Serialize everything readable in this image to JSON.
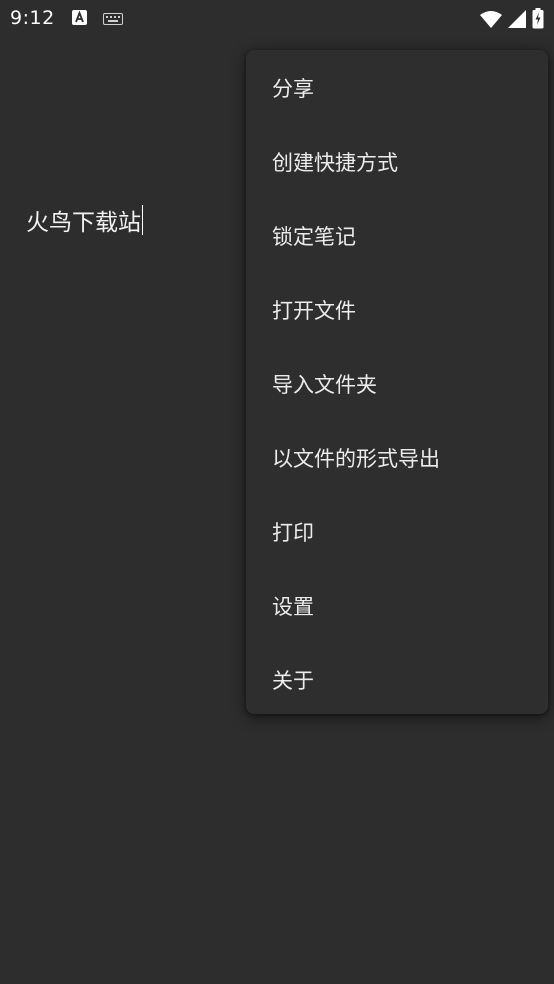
{
  "status_bar": {
    "time": "9:12",
    "notification_icons": [
      "font-a-icon",
      "keyboard-icon"
    ],
    "system_icons": [
      "wifi-icon",
      "cell-signal-icon",
      "battery-charging-icon"
    ]
  },
  "editor": {
    "note_text": "火鸟下载站"
  },
  "menu": {
    "items": [
      {
        "label": "分享"
      },
      {
        "label": "创建快捷方式"
      },
      {
        "label": "锁定笔记"
      },
      {
        "label": "打开文件"
      },
      {
        "label": "导入文件夹"
      },
      {
        "label": "以文件的形式导出"
      },
      {
        "label": "打印"
      },
      {
        "label": "设置"
      },
      {
        "label": "关于"
      }
    ]
  },
  "colors": {
    "background": "#2d2d2d",
    "menu_background": "#2e2e2e",
    "text": "#ececec"
  }
}
